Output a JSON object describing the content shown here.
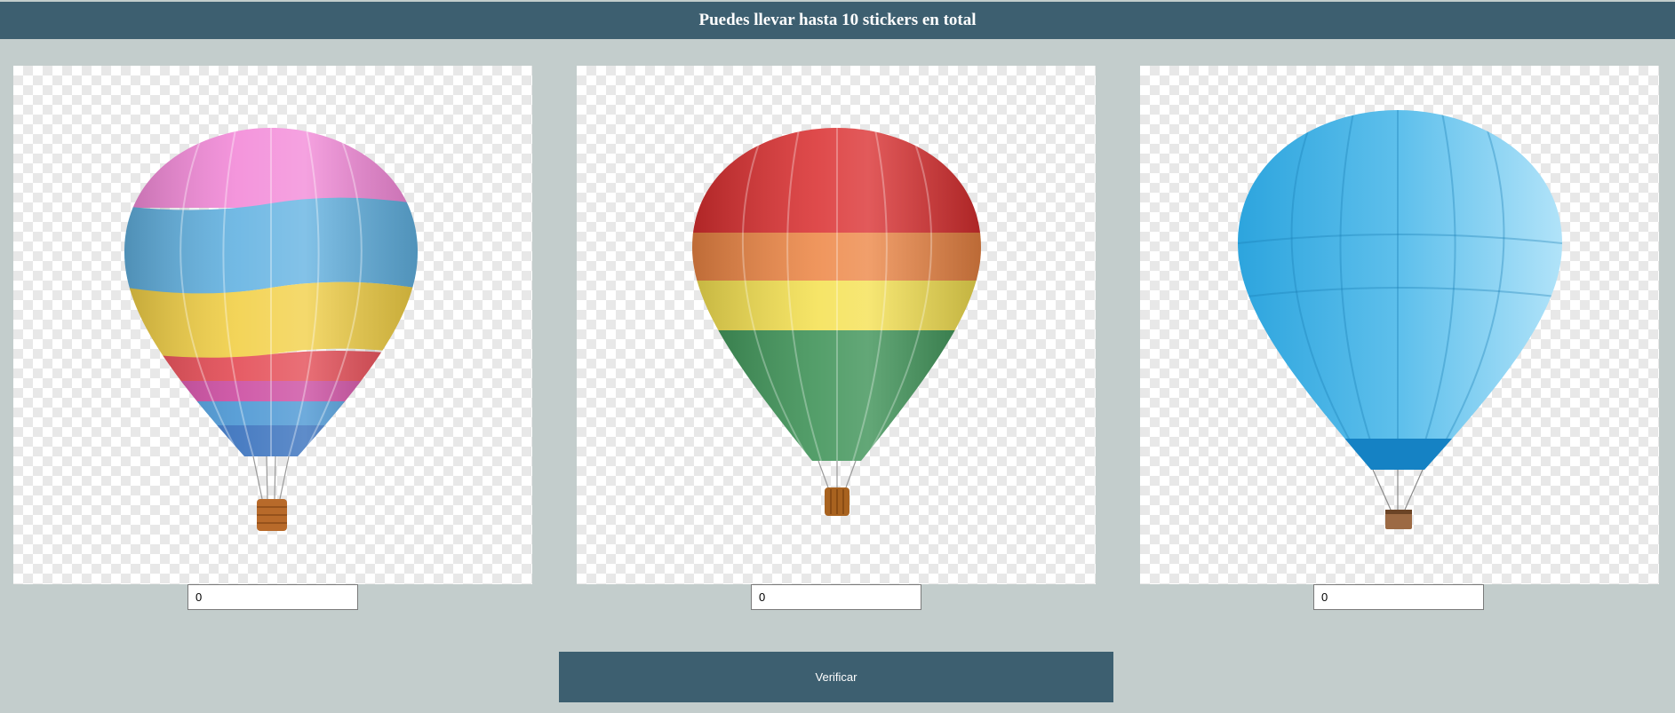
{
  "header": {
    "title": "Puedes llevar hasta 10 stickers en total"
  },
  "stickers": [
    {
      "image": "pink-blue-yellow-hot-air-balloon",
      "quantity": "0"
    },
    {
      "image": "red-orange-yellow-green-hot-air-balloon",
      "quantity": "0"
    },
    {
      "image": "light-blue-hot-air-balloon",
      "quantity": "0"
    }
  ],
  "actions": {
    "verify_label": "Verificar"
  },
  "colors": {
    "header_bg": "#3d5f70",
    "page_bg": "#c3cdcc",
    "button_bg": "#3d5f70"
  }
}
